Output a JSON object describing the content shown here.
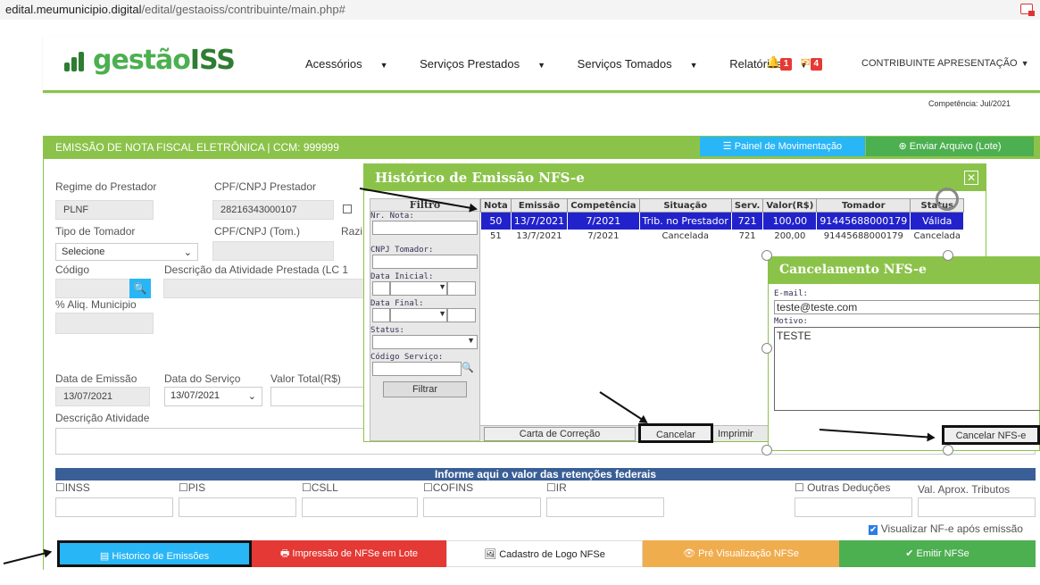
{
  "url": {
    "host": "edital.meumunicipio.digital",
    "path": "/edital/gestaoiss/contribuinte/main.php#"
  },
  "logo": {
    "text_a": "gest",
    "text_b": "ão",
    "text_c": "ISS"
  },
  "nav": {
    "items": [
      "Acessórios",
      "Serviços Prestados",
      "Serviços Tomados",
      "Relatórios"
    ],
    "bell_count": "1",
    "mail_count": "4",
    "user": "CONTRIBUINTE APRESENTAÇÃO"
  },
  "competencia": "Competência: Jul/2021",
  "main": {
    "title": "EMISSÃO DE NOTA FISCAL ELETRÔNICA | CCM: 999999",
    "painel_btn": "Painel de Movimentação",
    "enviar_btn": "Enviar Arquivo (Lote)"
  },
  "form": {
    "regime_label": "Regime do Prestador",
    "regime_value": "PLNF",
    "cpf_prest_label": "CPF/CNPJ Prestador",
    "cpf_prest_value": "28216343000107",
    "tipo_tomador_label": "Tipo de Tomador",
    "tipo_tomador_value": "Selecione",
    "cpf_tom_label": "CPF/CNPJ (Tom.)",
    "razao_label": "Razi",
    "codigo_label": "Código",
    "descricao_label": "Descrição da Atividade Prestada (LC 1",
    "aliq_label": "% Aliq. Municipio",
    "data_emissao_label": "Data de Emissão",
    "data_emissao_value": "13/07/2021",
    "data_servico_label": "Data do Serviço",
    "data_servico_value": "13/07/2021",
    "valor_total_label": "Valor Total(R$)",
    "descricao_atividade_label": "Descrição Atividade"
  },
  "retencoes": {
    "title": "Informe aqui o valor das retenções federais",
    "items": [
      "INSS",
      "PIS",
      "CSLL",
      "COFINS",
      "IR"
    ],
    "outras": "Outras Deduções",
    "aprox": "Val. Aprox. Tributos",
    "visualizar": "Visualizar NF-e após emissão"
  },
  "bottom": {
    "historico": "Historico de Emissões",
    "impressao": "Impressão de NFSe em Lote",
    "cadastro": "Cadastro de Logo NFSe",
    "pre": "Pré Visualização NFSe",
    "emitir": "Emitir NFSe"
  },
  "colors": {
    "green": "#8bc34a",
    "blue": "#29b6f6",
    "red": "#e53935",
    "orange": "#f0ad4e",
    "emit": "#4caf50"
  },
  "historico": {
    "title": "Histórico de Emissão NFS-e",
    "filtro": {
      "title": "Filtro",
      "nr_nota": "Nr. Nota:",
      "cnpj_tomador": "CNPJ Tomador:",
      "data_inicial": "Data Inicial:",
      "data_final": "Data Final:",
      "status": "Status:",
      "codigo_servico": "Código Serviço:",
      "filtrar": "Filtrar"
    },
    "columns": [
      "Nota",
      "Emissão",
      "Competência",
      "Situação",
      "Serv.",
      "Valor(R$)",
      "Tomador",
      "Status"
    ],
    "rows": [
      [
        "50",
        "13/7/2021",
        "7/2021",
        "Trib. no Prestador",
        "721",
        "100,00",
        "91445688000179",
        "Válida"
      ],
      [
        "51",
        "13/7/2021",
        "7/2021",
        "Cancelada",
        "721",
        "200,00",
        "91445688000179",
        "Cancelada"
      ]
    ],
    "carta": "Carta de Correção",
    "cancelar": "Cancelar",
    "imprimir": "Imprimir"
  },
  "cancelamento": {
    "title": "Cancelamento NFS-e",
    "email_label": "E-mail:",
    "email_value": "teste@teste.com",
    "motivo_label": "Motivo:",
    "motivo_value": "TESTE",
    "btn": "Cancelar NFS-e"
  }
}
